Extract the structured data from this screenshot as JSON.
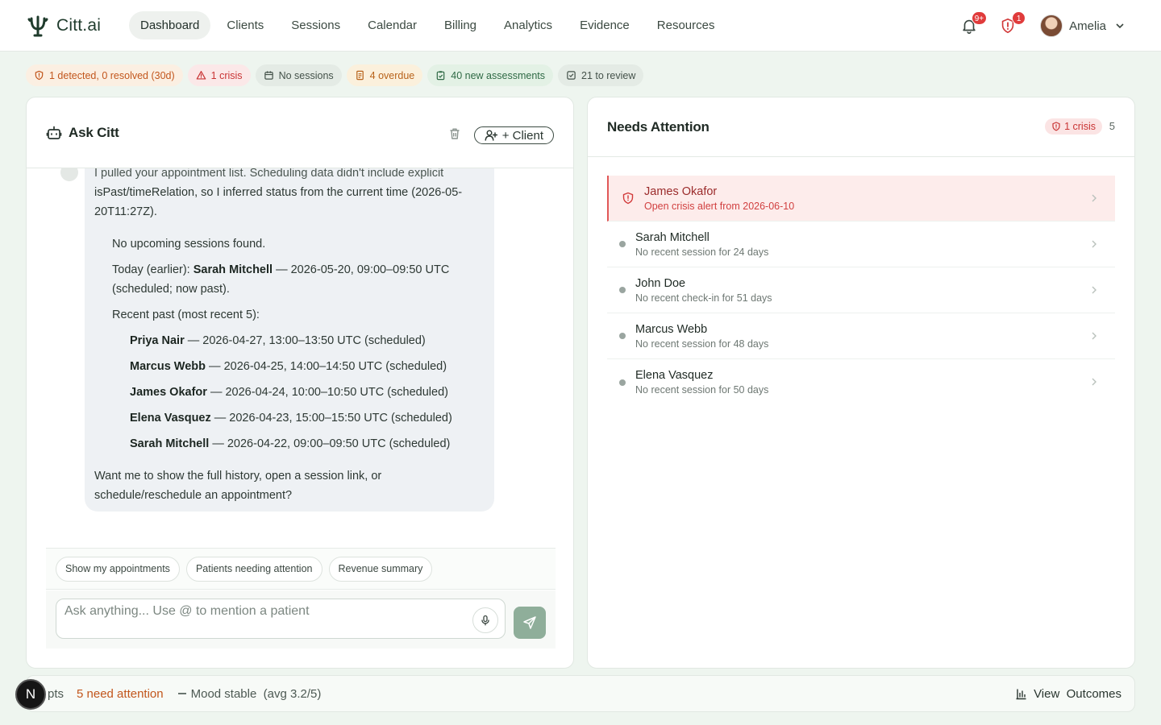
{
  "app": {
    "name": "Citt.ai"
  },
  "nav": {
    "items": [
      "Dashboard",
      "Clients",
      "Sessions",
      "Calendar",
      "Billing",
      "Analytics",
      "Evidence",
      "Resources"
    ],
    "active": "Dashboard"
  },
  "header": {
    "notifications_badge": "9+",
    "alerts_badge": "1",
    "user_name": "Amelia"
  },
  "status_chips": [
    {
      "label": "1 detected, 0 resolved (30d)",
      "icon": "shield-alert-icon",
      "tone": "orange"
    },
    {
      "label": "1 crisis",
      "icon": "warning-triangle-icon",
      "tone": "red"
    },
    {
      "label": "No sessions",
      "icon": "calendar-icon",
      "tone": "grey"
    },
    {
      "label": "4 overdue",
      "icon": "invoice-icon",
      "tone": "amber"
    },
    {
      "label": "40 new assessments",
      "icon": "clipboard-check-icon",
      "tone": "green"
    },
    {
      "label": "21 to review",
      "icon": "checkbox-icon",
      "tone": "grey"
    }
  ],
  "ask_panel": {
    "title": "Ask Citt",
    "client_button": "+ Client",
    "message": {
      "intro_cut": "I pulled your appointment list. Scheduling data didn't include explicit",
      "intro": "isPast/timeRelation, so I inferred status from the current time (2026-05-20T11:27Z).",
      "no_upcoming": "No upcoming sessions found.",
      "today_label": "Today (earlier): ",
      "today_name": "Sarah Mitchell",
      "today_detail": " — 2026-05-20, 09:00–09:50 UTC (scheduled; now past).",
      "recent_label": "Recent past (most recent 5):",
      "recent": [
        {
          "name": "Priya Nair",
          "detail": " — 2026-04-27, 13:00–13:50 UTC (scheduled)"
        },
        {
          "name": "Marcus Webb",
          "detail": " — 2026-04-25, 14:00–14:50 UTC (scheduled)"
        },
        {
          "name": "James Okafor",
          "detail": " — 2026-04-24, 10:00–10:50 UTC (scheduled)"
        },
        {
          "name": "Elena Vasquez",
          "detail": " — 2026-04-23, 15:00–15:50 UTC (scheduled)"
        },
        {
          "name": "Sarah Mitchell",
          "detail": " — 2026-04-22, 09:00–09:50 UTC (scheduled)"
        }
      ],
      "closing": "Want me to show the full history, open a session link, or schedule/reschedule an appointment?"
    },
    "suggestions": [
      "Show my appointments",
      "Patients needing attention",
      "Revenue summary"
    ],
    "input_placeholder": "Ask anything... Use @ to mention a patient"
  },
  "needs_attention": {
    "title": "Needs Attention",
    "crisis_label": "1 crisis",
    "count": "5",
    "items": [
      {
        "name": "James Okafor",
        "sub": "Open crisis alert from 2026-06-10",
        "crisis": true
      },
      {
        "name": "Sarah Mitchell",
        "sub": "No recent session for 24 days",
        "crisis": false
      },
      {
        "name": "John Doe",
        "sub": "No recent check-in for 51 days",
        "crisis": false
      },
      {
        "name": "Marcus Webb",
        "sub": "No recent session for 48 days",
        "crisis": false
      },
      {
        "name": "Elena Vasquez",
        "sub": "No recent session for 50 days",
        "crisis": false
      }
    ]
  },
  "bottom_bar": {
    "n_button": "N",
    "pts": "pts",
    "attention": "5 need attention",
    "mood": "Mood stable  (avg 3.2/5)",
    "view_outcomes": "View  Outcomes"
  },
  "colors": {
    "brand": "#1f3b2c",
    "accent_send": "#8fae9a",
    "crisis": "#e15757",
    "warning": "#c2561c"
  }
}
